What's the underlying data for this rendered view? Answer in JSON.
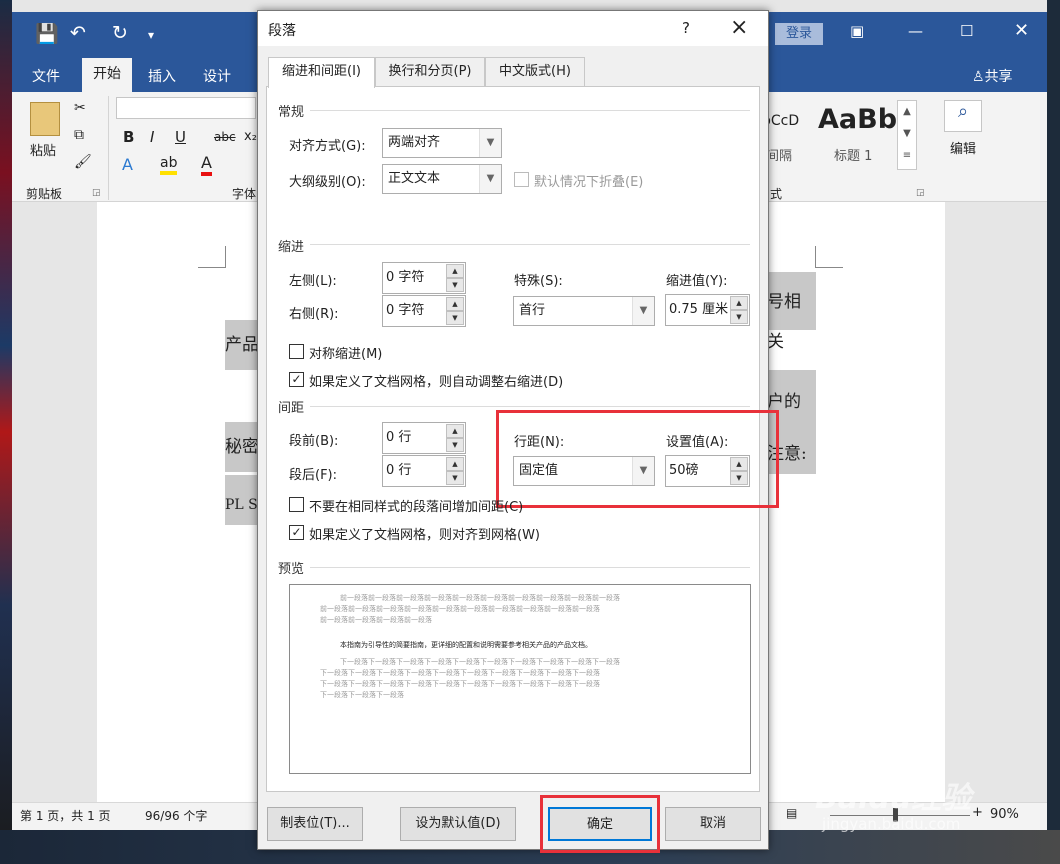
{
  "word": {
    "quick_access": {
      "save": "save-icon",
      "undo": "undo-icon",
      "redo": "redo-icon",
      "customize": "customize-icon"
    },
    "titlebar": {
      "login": "登录",
      "share": "共享"
    },
    "tabs": [
      "文件",
      "开始",
      "插入",
      "设计"
    ],
    "clipboard": {
      "paste": "粘贴",
      "group": "剪贴板"
    },
    "font": {
      "bold": "B",
      "italic": "I",
      "underline": "U",
      "strike": "abc",
      "sub": "x₂",
      "group": "字体"
    },
    "styles": {
      "item1_sample": "bCcD",
      "item1_label": "间隔",
      "item2_sample": "AaBb",
      "item2_label": "标题 1",
      "group": "式"
    },
    "editing": {
      "label": "编辑"
    },
    "doc_text": {
      "r1": "号相关",
      "r2": "产品",
      "r3": "户的",
      "r4": "秘密",
      "r5": "注意:",
      "r6": "PL S"
    },
    "status": {
      "page": "第 1 页，共 1 页",
      "words": "96/96 个字",
      "zoom": "90%"
    }
  },
  "dialog": {
    "title": "段落",
    "help": "?",
    "close": "×",
    "tabs": [
      "缩进和间距(I)",
      "换行和分页(P)",
      "中文版式(H)"
    ],
    "general": {
      "heading": "常规",
      "align_label": "对齐方式(G):",
      "align_value": "两端对齐",
      "outline_label": "大纲级别(O):",
      "outline_value": "正文文本",
      "collapse_label": "默认情况下折叠(E)"
    },
    "indent": {
      "heading": "缩进",
      "left_label": "左侧(L):",
      "left_value": "0 字符",
      "right_label": "右侧(R):",
      "right_value": "0 字符",
      "special_label": "特殊(S):",
      "special_value": "首行",
      "by_label": "缩进值(Y):",
      "by_value": "0.75 厘米",
      "mirror_label": "对称缩进(M)",
      "auto_label": "如果定义了文档网格，则自动调整右缩进(D)"
    },
    "spacing": {
      "heading": "间距",
      "before_label": "段前(B):",
      "before_value": "0 行",
      "after_label": "段后(F):",
      "after_value": "0 行",
      "line_label": "行距(N):",
      "line_value": "固定值",
      "at_label": "设置值(A):",
      "at_value": "50磅",
      "nospace_label": "不要在相同样式的段落间增加间距(C)",
      "snap_label": "如果定义了文档网格，则对齐到网格(W)"
    },
    "preview": {
      "heading": "预览",
      "prev1": "前一段落前一段落前一段落前一段落前一段落前一段落前一段落前一段落前一段落前一段落",
      "prev2": "前一段落前一段落前一段落前一段落前一段落前一段落前一段落前一段落前一段落前一段落",
      "prev3": "前一段落前一段落前一段落前一段落",
      "sample": "本指南为引导性的简要指南，更详细的配置和说明需要参考相关产品的产品文档。",
      "next1": "下一段落下一段落下一段落下一段落下一段落下一段落下一段落下一段落下一段落下一段落",
      "next2": "下一段落下一段落下一段落下一段落下一段落下一段落下一段落下一段落下一段落下一段落",
      "next3": "下一段落下一段落下一段落下一段落下一段落下一段落下一段落下一段落下一段落下一段落",
      "next4": "下一段落下一段落下一段落"
    },
    "buttons": {
      "tabs": "制表位(T)...",
      "default": "设为默认值(D)",
      "ok": "确定",
      "cancel": "取消"
    }
  },
  "watermark": {
    "text": "Baidu经验",
    "url": "jingyan.baidu.com"
  },
  "colors": {
    "word_blue": "#2b579a",
    "highlight_red": "#e8313a"
  }
}
